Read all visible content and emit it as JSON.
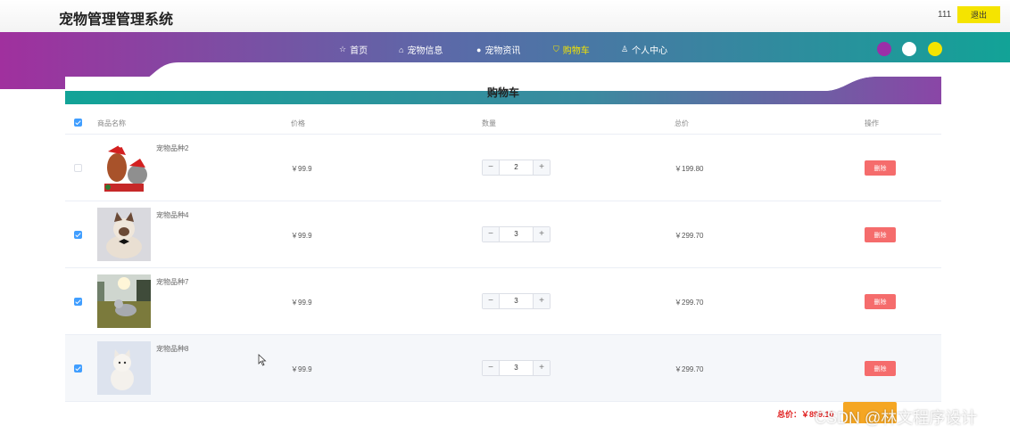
{
  "header": {
    "app_title": "宠物管理管理系统",
    "username": "111",
    "logout_label": "退出"
  },
  "nav": {
    "items": [
      {
        "label": "首页",
        "icon": "star-icon"
      },
      {
        "label": "宠物信息",
        "icon": "home-icon"
      },
      {
        "label": "宠物资讯",
        "icon": "circle-icon"
      },
      {
        "label": "购物车",
        "icon": "cart-icon",
        "active": true
      },
      {
        "label": "个人中心",
        "icon": "user-icon"
      }
    ],
    "theme_dots": [
      "#9b2fa8",
      "#ffffff",
      "#f5e400"
    ]
  },
  "cart": {
    "title": "购物车",
    "columns": [
      "商品名称",
      "价格",
      "数量",
      "总价",
      "操作"
    ],
    "rows": [
      {
        "name": "宠物品种2",
        "price": "￥99.9",
        "qty": "2",
        "total": "￥199.80",
        "checked": false,
        "action": "删除"
      },
      {
        "name": "宠物品种4",
        "price": "￥99.9",
        "qty": "3",
        "total": "￥299.70",
        "checked": true,
        "action": "删除"
      },
      {
        "name": "宠物品种7",
        "price": "￥99.9",
        "qty": "3",
        "total": "￥299.70",
        "checked": true,
        "action": "删除"
      },
      {
        "name": "宠物品种8",
        "price": "￥99.9",
        "qty": "3",
        "total": "￥299.70",
        "checked": true,
        "action": "删除"
      }
    ],
    "stepper_minus": "−",
    "stepper_plus": "+",
    "summary": "总价：￥899.10"
  },
  "watermark": "CSDN @林文程序设计",
  "colors": {
    "accent_teal": "#17a59a",
    "accent_purple": "#a0309e",
    "delete": "#f56c6c",
    "checkbox": "#409eff",
    "logout": "#f5e400"
  }
}
